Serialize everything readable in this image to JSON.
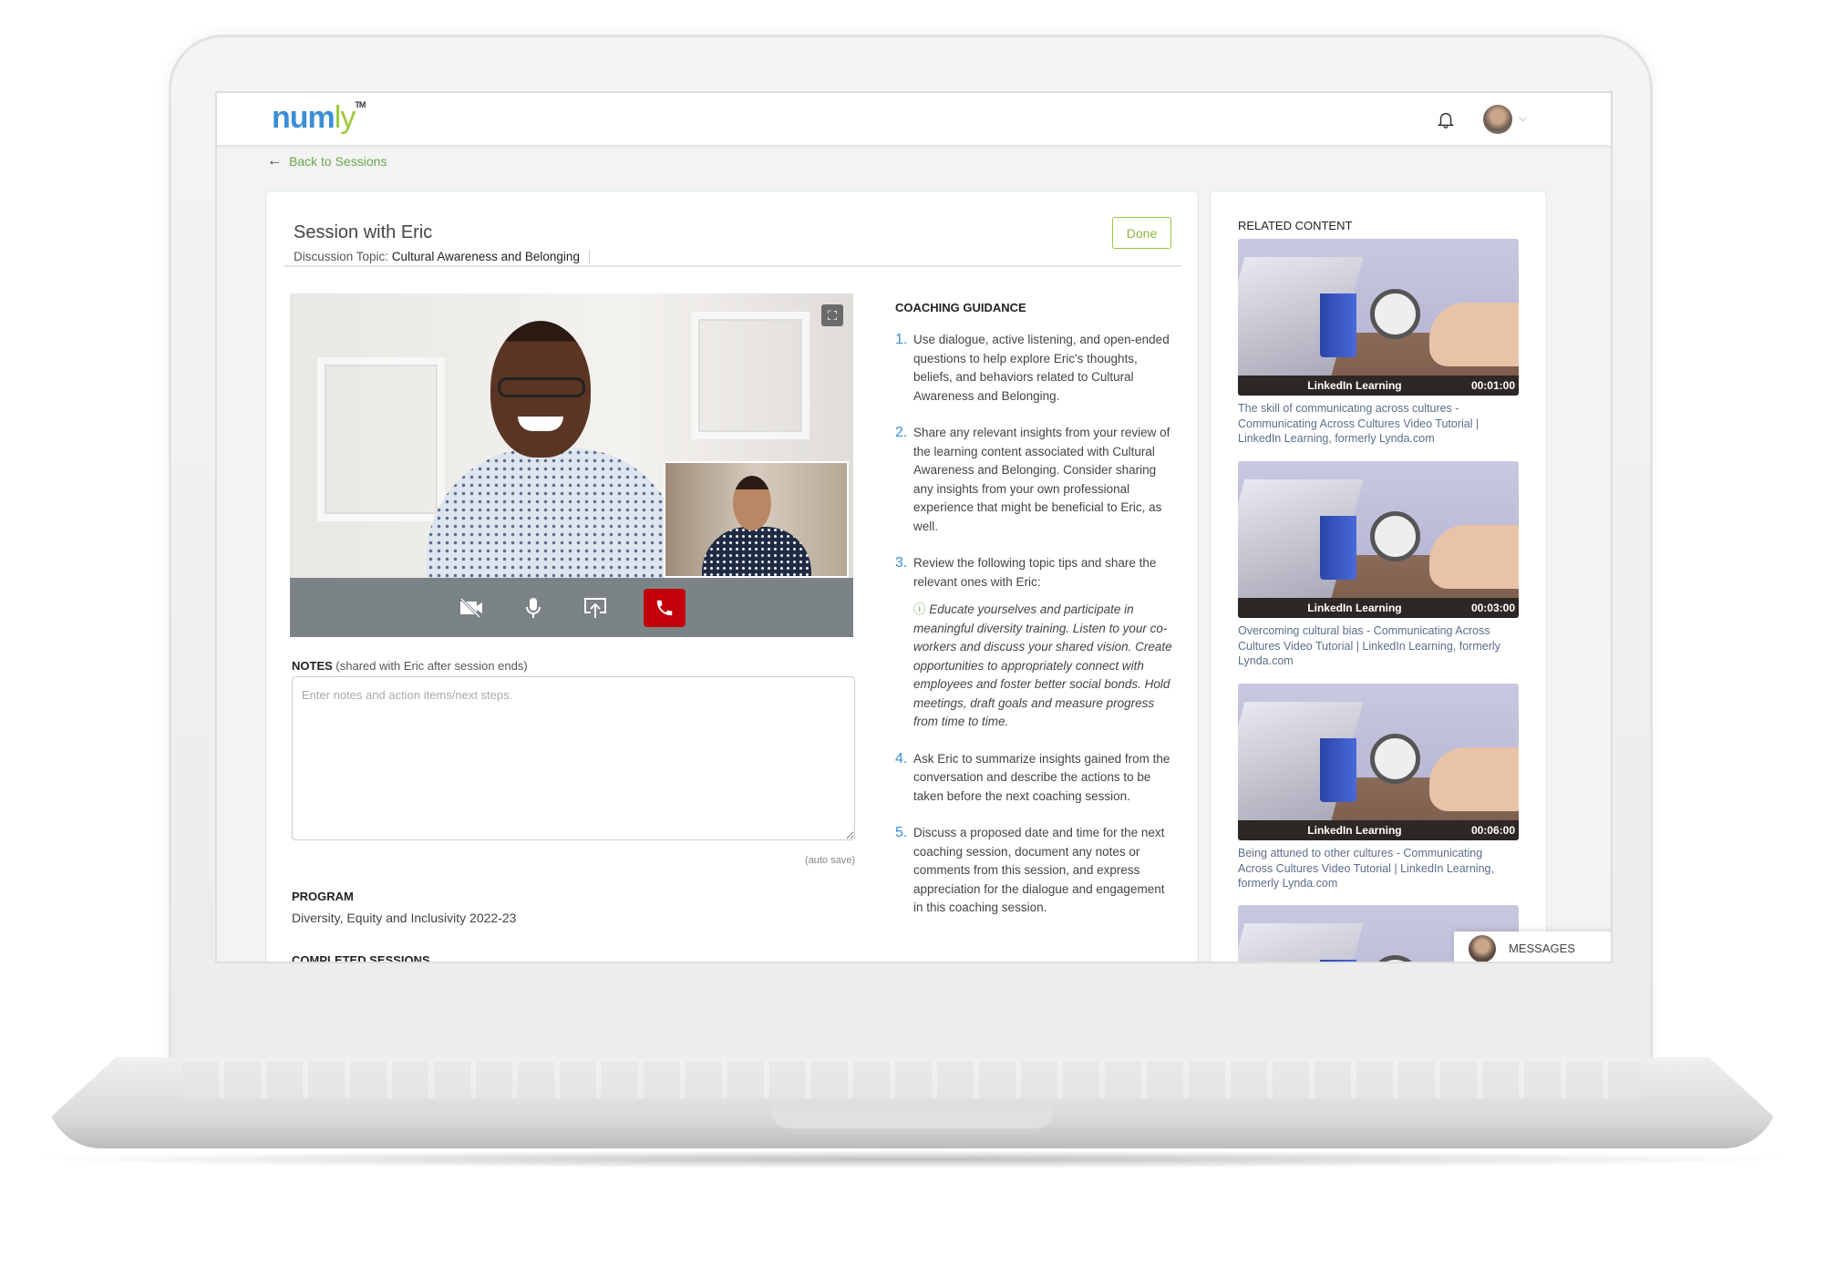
{
  "header": {
    "logo_main": "num",
    "logo_accent": "ly",
    "logo_tm": "TM",
    "bell_icon": "bell-icon",
    "avatar_icon": "user-avatar",
    "chevron": "⌄"
  },
  "nav": {
    "back_label": "Back to Sessions",
    "back_icon": "arrow-left-icon"
  },
  "session": {
    "title": "Session with Eric",
    "topic_label": "Discussion Topic:",
    "topic_value": "Cultural Awareness and Belonging",
    "done_label": "Done"
  },
  "video": {
    "controls": [
      "camera-off-icon",
      "microphone-icon",
      "share-screen-icon",
      "hang-up-icon"
    ],
    "hangup_color": "#c4000b",
    "expand_icon": "expand-icon"
  },
  "notes": {
    "label": "NOTES",
    "label_note": "(shared with Eric after session ends)",
    "placeholder": "Enter notes and action items/next steps.",
    "value": "",
    "autosave": "(auto save)"
  },
  "program": {
    "label": "PROGRAM",
    "value": "Diversity, Equity and Inclusivity 2022-23"
  },
  "completed": {
    "label": "COMPLETED SESSIONS"
  },
  "guidance": {
    "title": "COACHING GUIDANCE",
    "items": [
      {
        "num": "1.",
        "text": "Use dialogue, active listening, and open-ended questions to help explore Eric's thoughts, beliefs, and behaviors related to Cultural Awareness and Belonging."
      },
      {
        "num": "2.",
        "text": "Share any relevant insights from your review of the learning content associated with Cultural Awareness and Belonging. Consider sharing any insights from your own professional experience that might be beneficial to Eric, as well."
      },
      {
        "num": "3.",
        "text": "Review the following topic tips and share the relevant ones with Eric:",
        "tip": "Educate yourselves and participate in meaningful diversity training. Listen to your co-workers and discuss your shared vision. Create opportunities to appropriately connect with employees and foster better social bonds. Hold meetings, draft goals and measure progress from time to time."
      },
      {
        "num": "4.",
        "text": "Ask Eric to summarize insights gained from the conversation and describe the actions to be taken before the next coaching session."
      },
      {
        "num": "5.",
        "text": "Discuss a proposed date and time for the next coaching session, document any notes or comments from this session, and express appreciation for the dialogue and engagement in this coaching session."
      }
    ]
  },
  "related": {
    "title": "RELATED CONTENT",
    "items": [
      {
        "source": "LinkedIn Learning",
        "duration": "00:01:00",
        "caption": "The skill of communicating across cultures - Communicating Across Cultures Video Tutorial | LinkedIn Learning, formerly Lynda.com"
      },
      {
        "source": "LinkedIn Learning",
        "duration": "00:03:00",
        "caption": "Overcoming cultural bias - Communicating Across Cultures Video Tutorial | LinkedIn Learning, formerly Lynda.com"
      },
      {
        "source": "LinkedIn Learning",
        "duration": "00:06:00",
        "caption": "Being attuned to other cultures - Communicating Across Cultures Video Tutorial | LinkedIn Learning, formerly Lynda.com"
      }
    ]
  },
  "messages": {
    "label": "MESSAGES"
  },
  "colors": {
    "brand_blue": "#3a8fd6",
    "brand_green": "#9bc83c",
    "link_green": "#6aa84f"
  }
}
